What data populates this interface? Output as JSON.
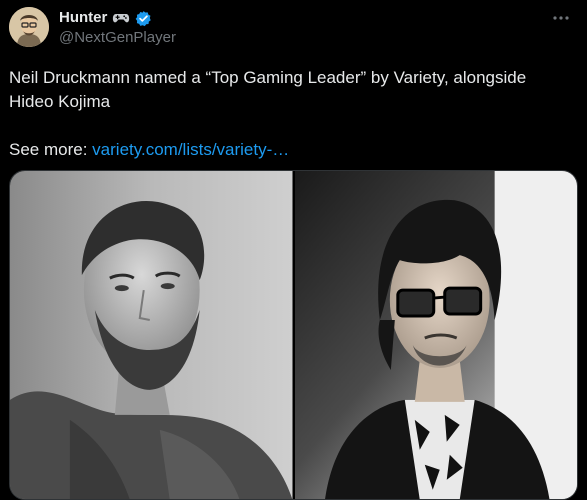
{
  "author": {
    "display_name": "Hunter",
    "handle": "@NextGenPlayer",
    "badge_icon": "gamepad-icon",
    "verified_icon": "verified-badge-icon",
    "verified_color": "#1d9bf0"
  },
  "tweet": {
    "line1": "Neil Druckmann named a “Top Gaming Leader” by Variety, alongside Hideo Kojima",
    "see_more_label": "See more:",
    "link_text": "variety.com/lists/variety-…",
    "more_icon": "more-horizontal-icon"
  },
  "media": {
    "count": 2
  },
  "colors": {
    "background": "#000000",
    "text": "#e7e9ea",
    "muted": "#71767b",
    "link": "#1d9bf0",
    "border": "#2f3336"
  }
}
